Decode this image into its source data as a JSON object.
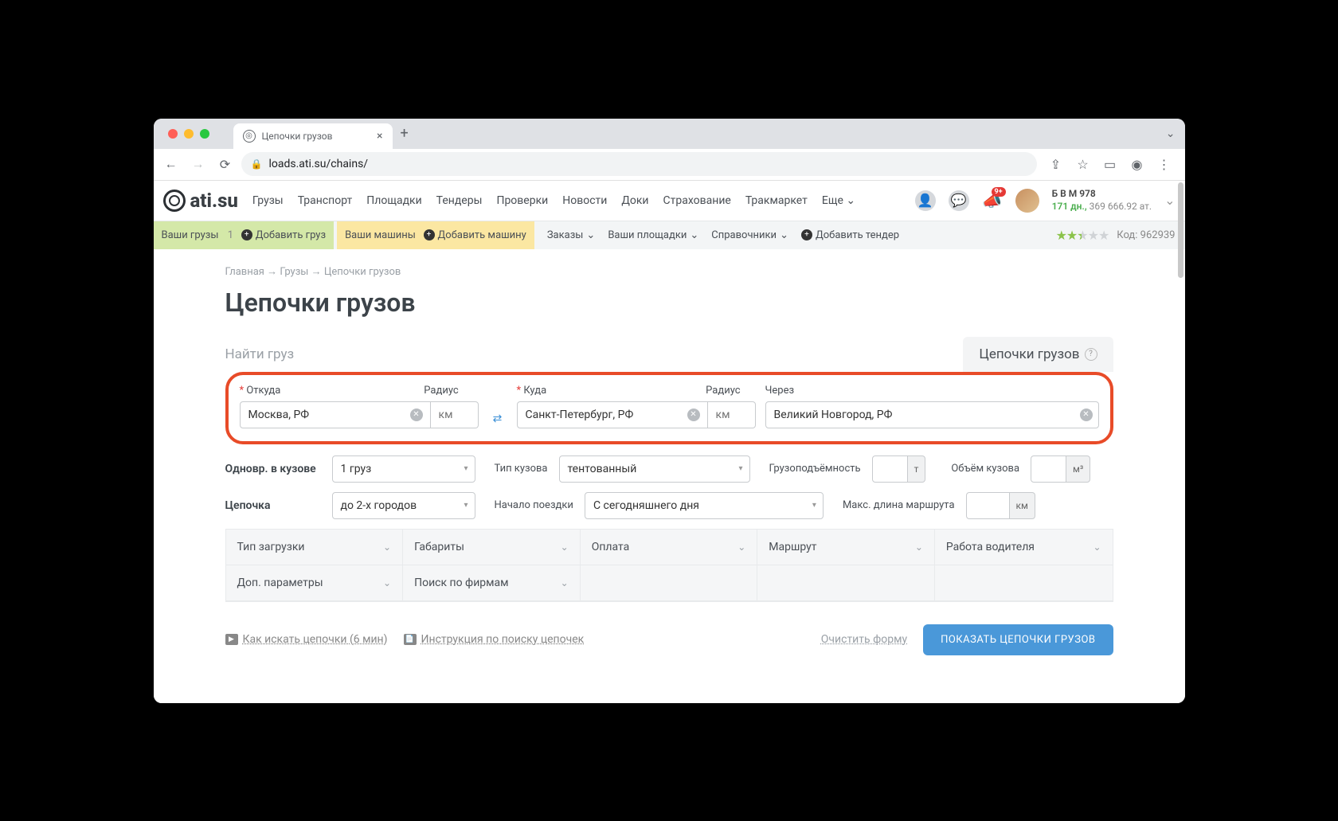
{
  "browser": {
    "tab_title": "Цепочки грузов",
    "url": "loads.ati.su/chains/"
  },
  "header": {
    "logo_text": "ati.su",
    "nav": [
      "Грузы",
      "Транспорт",
      "Площадки",
      "Тендеры",
      "Проверки",
      "Новости",
      "Доки",
      "Страхование",
      "Тракмаркет",
      "Еще"
    ],
    "badge": "9+",
    "user_name": "Б В М 978",
    "user_days": "171 дн.,",
    "user_balance": "369 666.92 ат."
  },
  "subheader": {
    "your_cargo": "Ваши грузы",
    "your_cargo_count": "1",
    "add_cargo": "Добавить груз",
    "your_trucks": "Ваши машины",
    "add_truck": "Добавить машину",
    "orders": "Заказы",
    "your_sites": "Ваши площадки",
    "refs": "Справочники",
    "add_tender": "Добавить тендер",
    "code_label": "Код:",
    "code_value": "962939"
  },
  "breadcrumb": {
    "home": "Главная",
    "section": "Грузы",
    "current": "Цепочки грузов"
  },
  "page_title": "Цепочки грузов",
  "tabs": {
    "find": "Найти груз",
    "chains": "Цепочки грузов"
  },
  "route": {
    "from_label": "Откуда",
    "radius_label": "Радиус",
    "radius_unit": "км",
    "from_value": "Москва, РФ",
    "to_label": "Куда",
    "to_value": "Санкт-Петербург, РФ",
    "via_label": "Через",
    "via_value": "Великий Новгород, РФ"
  },
  "params": {
    "simul_label": "Одновр. в кузове",
    "simul_value": "1 груз",
    "body_type_label": "Тип кузова",
    "body_type_value": "тентованный",
    "capacity_label": "Грузоподъёмность",
    "capacity_unit": "т",
    "volume_label": "Объём кузова",
    "volume_unit": "м³",
    "chain_label": "Цепочка",
    "chain_value": "до 2-х городов",
    "start_label": "Начало поездки",
    "start_value": "С сегодняшнего дня",
    "maxlen_label": "Макс. длина маршрута",
    "maxlen_unit": "км"
  },
  "filters": [
    "Тип загрузки",
    "Габариты",
    "Оплата",
    "Маршрут",
    "Работа водителя",
    "Доп. параметры",
    "Поиск по фирмам"
  ],
  "footer": {
    "video": "Как искать цепочки (6 мин)",
    "manual": "Инструкция по поиску цепочек",
    "clear": "Очистить форму",
    "submit": "ПОКАЗАТЬ ЦЕПОЧКИ ГРУЗОВ"
  }
}
